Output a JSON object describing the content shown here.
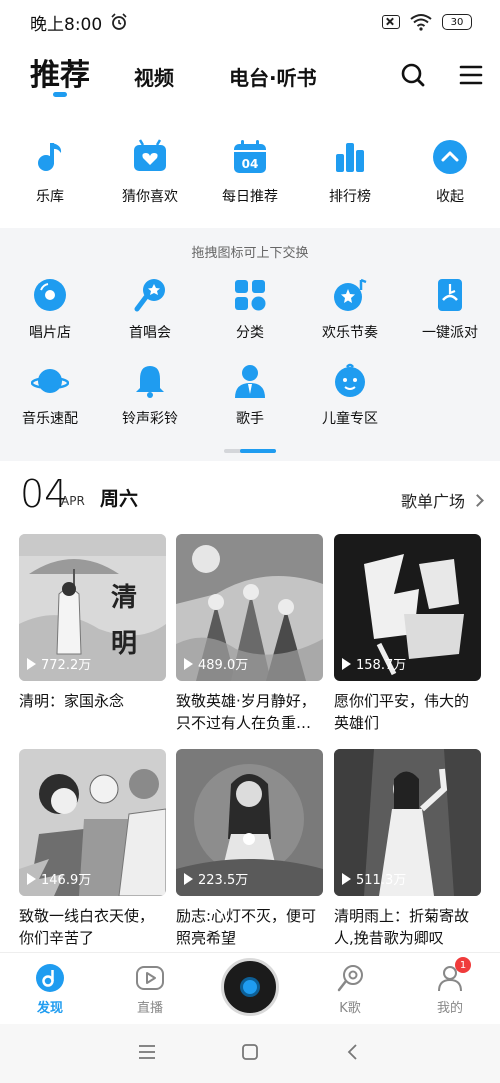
{
  "status_bar": {
    "time": "晚上8:00",
    "battery": "30"
  },
  "top_tabs": [
    {
      "label": "推荐",
      "active": true
    },
    {
      "label": "视频"
    },
    {
      "label": "电台·听书"
    }
  ],
  "quick_entries": [
    "乐库",
    "猜你喜欢",
    "每日推荐",
    "排行榜",
    "收起"
  ],
  "daily_icon_text": "04",
  "panel": {
    "hint": "拖拽图标可上下交换",
    "items": [
      "唱片店",
      "首唱会",
      "分类",
      "欢乐节奏",
      "一键派对",
      "音乐速配",
      "铃声彩铃",
      "歌手",
      "儿童专区"
    ]
  },
  "date": {
    "day": "04",
    "month": "APR",
    "weekday": "周六",
    "plaza": "歌单广场"
  },
  "playlists": [
    {
      "plays": "772.2万",
      "title": "清明：家国永念"
    },
    {
      "plays": "489.0万",
      "title": "致敬英雄·岁月静好，只不过有人在负重…"
    },
    {
      "plays": "158.7万",
      "title": "愿你们平安，伟大的英雄们"
    },
    {
      "plays": "146.9万",
      "title": "致敬一线白衣天使，你们辛苦了"
    },
    {
      "plays": "223.5万",
      "title": "励志:心灯不灭，便可照亮希望"
    },
    {
      "plays": "511.3万",
      "title": "清明雨上：折菊寄故人,挽昔歌为卿叹"
    }
  ],
  "bottom_nav": [
    {
      "label": "发现",
      "active": true
    },
    {
      "label": "直播"
    },
    {
      "label": "K歌"
    },
    {
      "label": "我的",
      "badge": "1"
    }
  ],
  "colors": {
    "accent": "#1f9cf0",
    "badge": "#f03b3b"
  }
}
